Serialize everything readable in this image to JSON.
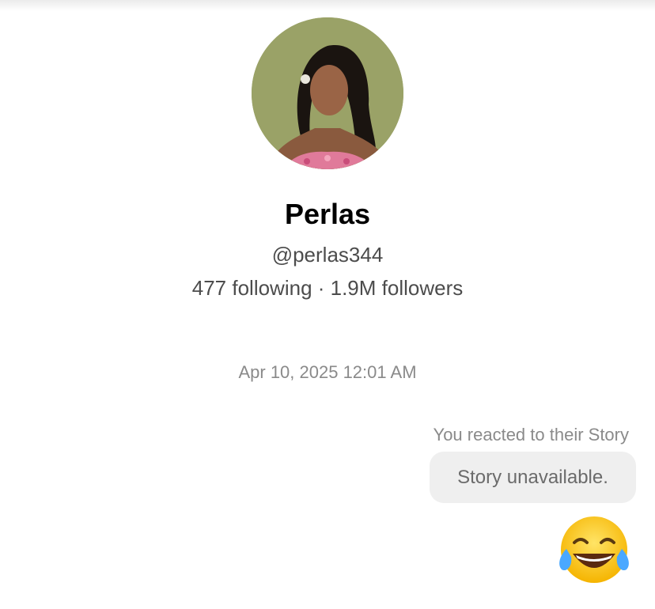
{
  "profile": {
    "name": "Perlas",
    "handle": "@perlas344",
    "stats": "477 following · 1.9M followers"
  },
  "conversation": {
    "timestamp": "Apr 10, 2025 12:01 AM",
    "reaction_note": "You reacted to their Story",
    "story_bubble": "Story unavailable.",
    "reaction_emoji": "face-with-tears-of-joy-icon"
  },
  "colors": {
    "avatar_background": "#9aa267",
    "bubble_background": "#efefef",
    "secondary_text": "#8a8a8a"
  }
}
